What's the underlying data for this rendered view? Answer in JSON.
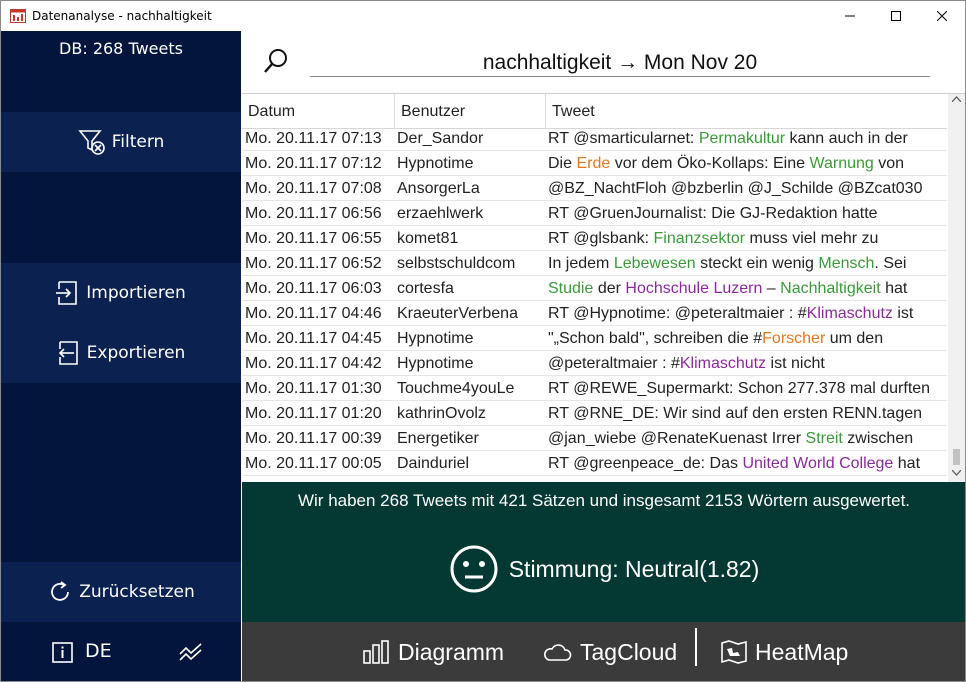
{
  "window": {
    "title": "Datenanalyse - nachhaltigkeit"
  },
  "sidebar": {
    "db_count": "DB: 268 Tweets",
    "filter_label": "Filtern",
    "import_label": "Importieren",
    "export_label": "Exportieren",
    "reset_label": "Zurücksetzen",
    "language": "DE"
  },
  "search": {
    "query": "nachhaltigkeit → Mon Nov 20"
  },
  "table": {
    "columns": [
      "Datum",
      "Benutzer",
      "Tweet"
    ],
    "rows": [
      {
        "date": "Mo. 20.11.17 07:13",
        "user": "Der_Sandor",
        "tweet": [
          {
            "t": "RT @smarticularnet: ",
            "c": ""
          },
          {
            "t": "Permakultur",
            "c": "g"
          },
          {
            "t": " kann auch in der",
            "c": ""
          }
        ]
      },
      {
        "date": "Mo. 20.11.17 07:12",
        "user": "Hypnotime",
        "tweet": [
          {
            "t": "Die ",
            "c": ""
          },
          {
            "t": "Erde",
            "c": "o"
          },
          {
            "t": " vor dem Öko-Kollaps: Eine ",
            "c": ""
          },
          {
            "t": "Warnung",
            "c": "g"
          },
          {
            "t": " von",
            "c": ""
          }
        ]
      },
      {
        "date": "Mo. 20.11.17 07:08",
        "user": "AnsorgerLa",
        "tweet": [
          {
            "t": "@BZ_NachtFloh @bzberlin @J_Schilde @BZcat030",
            "c": ""
          }
        ]
      },
      {
        "date": "Mo. 20.11.17 06:56",
        "user": "erzaehlwerk",
        "tweet": [
          {
            "t": "RT @GruenJournalist: Die GJ-Redaktion hatte",
            "c": ""
          }
        ]
      },
      {
        "date": "Mo. 20.11.17 06:55",
        "user": "komet81",
        "tweet": [
          {
            "t": "RT @glsbank: ",
            "c": ""
          },
          {
            "t": "Finanzsektor",
            "c": "g"
          },
          {
            "t": " muss viel mehr zu",
            "c": ""
          }
        ]
      },
      {
        "date": "Mo. 20.11.17 06:52",
        "user": "selbstschuldcom",
        "tweet": [
          {
            "t": "In jedem ",
            "c": ""
          },
          {
            "t": "Lebewesen",
            "c": "g"
          },
          {
            "t": " steckt ein wenig ",
            "c": ""
          },
          {
            "t": "Mensch",
            "c": "g"
          },
          {
            "t": ". Sei",
            "c": ""
          }
        ]
      },
      {
        "date": "Mo. 20.11.17 06:03",
        "user": "cortesfa",
        "tweet": [
          {
            "t": "Studie",
            "c": "g"
          },
          {
            "t": " der ",
            "c": ""
          },
          {
            "t": "Hochschule Luzern",
            "c": "p"
          },
          {
            "t": " – ",
            "c": ""
          },
          {
            "t": "Nachhaltigkeit",
            "c": "g"
          },
          {
            "t": " hat",
            "c": ""
          }
        ]
      },
      {
        "date": "Mo. 20.11.17 04:46",
        "user": "KraeuterVerbena",
        "tweet": [
          {
            "t": "RT @Hypnotime: @peteraltmaier : #",
            "c": ""
          },
          {
            "t": "Klimaschutz",
            "c": "p"
          },
          {
            "t": " ist",
            "c": ""
          }
        ]
      },
      {
        "date": "Mo. 20.11.17 04:45",
        "user": "Hypnotime",
        "tweet": [
          {
            "t": "\"„Schon bald\", schreiben die #",
            "c": ""
          },
          {
            "t": "Forscher",
            "c": "o"
          },
          {
            "t": " um den",
            "c": ""
          }
        ]
      },
      {
        "date": "Mo. 20.11.17 04:42",
        "user": "Hypnotime",
        "tweet": [
          {
            "t": "@peteraltmaier : #",
            "c": ""
          },
          {
            "t": "Klimaschutz",
            "c": "p"
          },
          {
            "t": " ist nicht",
            "c": ""
          }
        ]
      },
      {
        "date": "Mo. 20.11.17 01:30",
        "user": "Touchme4youLe",
        "tweet": [
          {
            "t": "RT @REWE_Supermarkt: Schon 277.378 mal durften",
            "c": ""
          }
        ]
      },
      {
        "date": "Mo. 20.11.17 01:20",
        "user": "kathrinOvolz",
        "tweet": [
          {
            "t": "RT @RNE_DE: Wir sind auf den ersten RENN.tagen",
            "c": ""
          }
        ]
      },
      {
        "date": "Mo. 20.11.17 00:39",
        "user": "Energetiker",
        "tweet": [
          {
            "t": "@jan_wiebe @RenateKuenast Irrer ",
            "c": ""
          },
          {
            "t": "Streit",
            "c": "g"
          },
          {
            "t": " zwischen",
            "c": ""
          }
        ]
      },
      {
        "date": "Mo. 20.11.17 00:05",
        "user": "Dainduriel",
        "tweet": [
          {
            "t": "RT @greenpeace_de: Das ",
            "c": ""
          },
          {
            "t": "United World College",
            "c": "p"
          },
          {
            "t": " hat",
            "c": ""
          }
        ]
      }
    ]
  },
  "summary": {
    "text": "Wir haben 268 Tweets mit 421 Sätzen und insgesamt 2153 Wörtern ausgewertet.",
    "mood": "Stimmung: Neutral(1.82)"
  },
  "bottom_nav": {
    "diagram_label": "Diagramm",
    "tagcloud_label": "TagCloud",
    "heatmap_label": "HeatMap"
  },
  "colors": {
    "sidebar_bg": "#03153d",
    "sidebar_button_bg": "#0b2150",
    "summary_bg": "#043832",
    "bottombar_bg": "#3b3b3b",
    "keyword_green": "#3a9a3a",
    "keyword_orange": "#e07820",
    "keyword_purple": "#8a2a9a"
  }
}
